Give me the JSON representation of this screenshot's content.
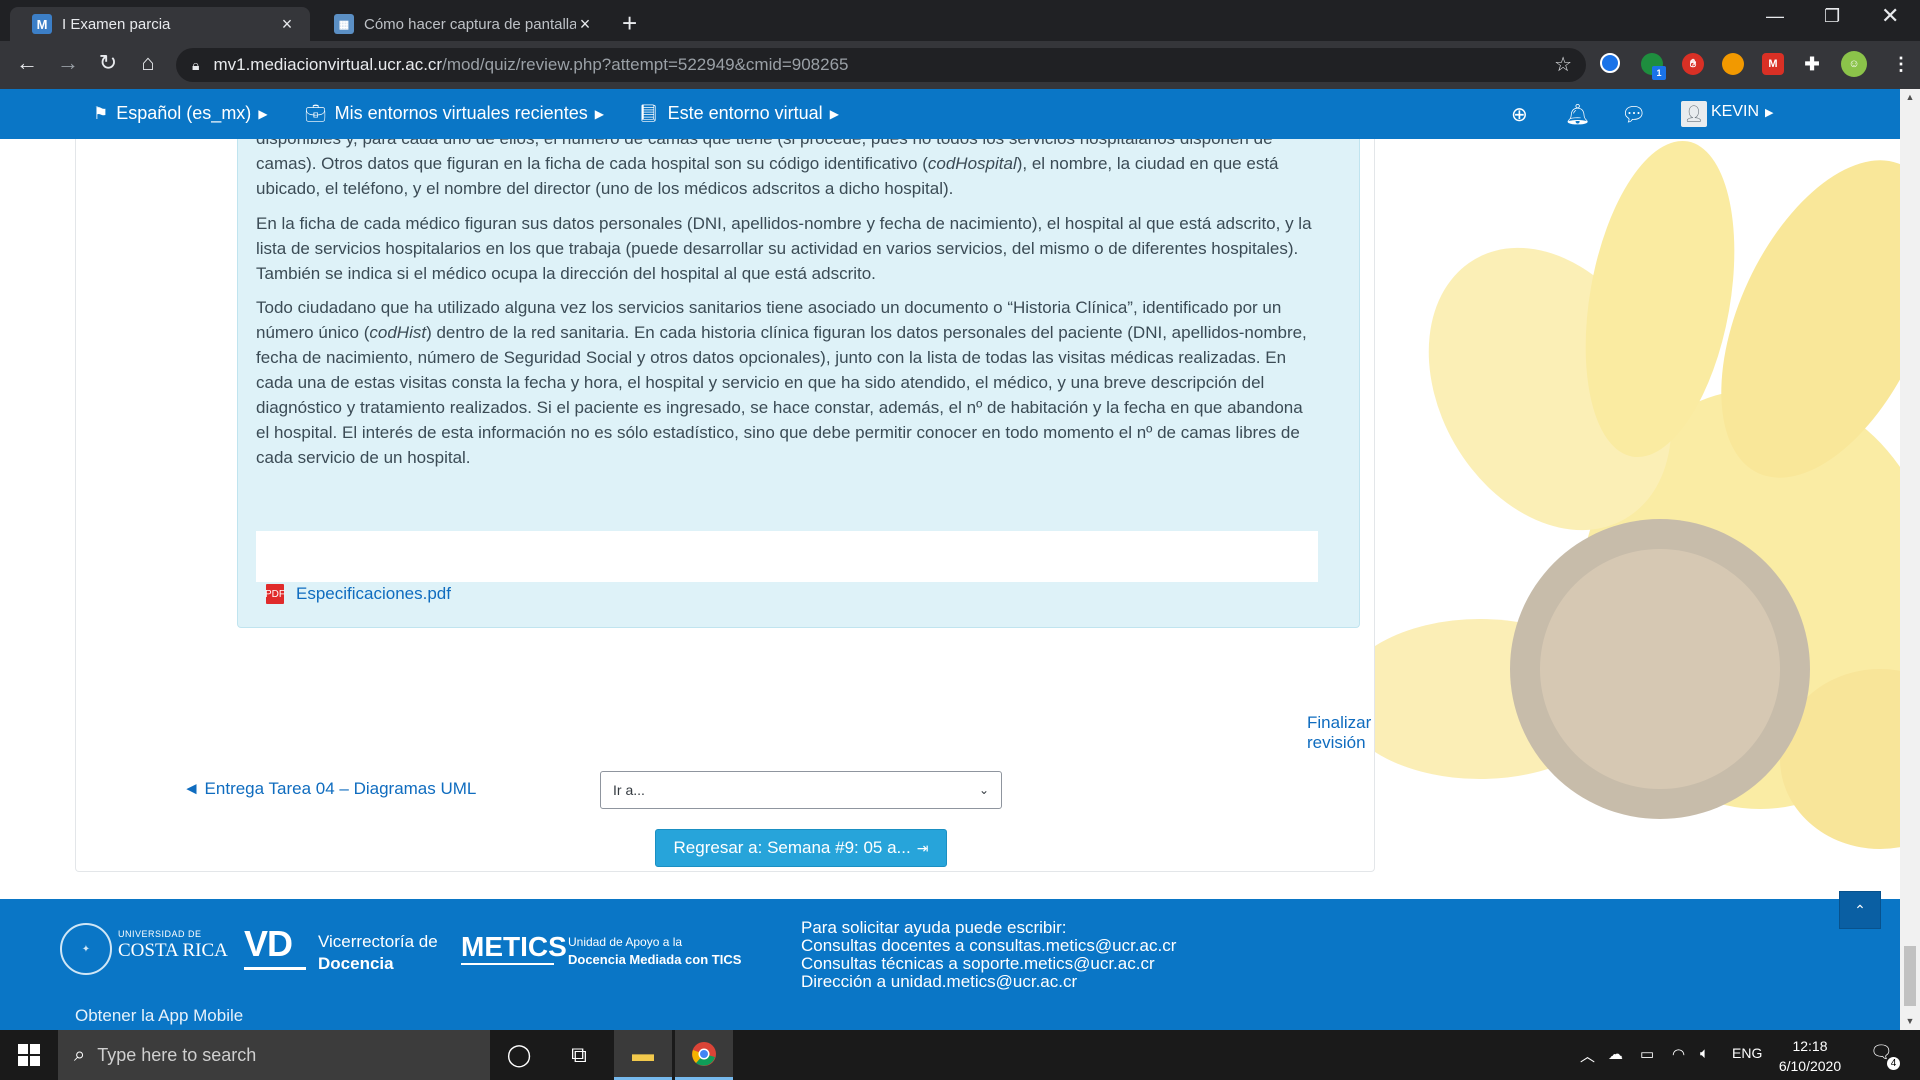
{
  "browser": {
    "tabs": [
      {
        "title": "I Examen parcia",
        "icon": "moodle-m-icon",
        "active": true
      },
      {
        "title": "Cómo hacer captura de pantalla",
        "icon": "page-image-icon",
        "active": false
      }
    ],
    "url_main": "mv1.mediacionvirtual.ucr.ac.cr",
    "url_path": "/mod/quiz/review.php?attempt=522949&cmid=908265",
    "new_tab_glyph": "+",
    "extensions": [
      "puzzle-icon",
      "profile-avatar-icon"
    ],
    "ext_badge": "1",
    "ext_m_label": "M"
  },
  "moodle_nav": {
    "language": "Español (es_mx)",
    "recent": "Mis entornos virtuales recientes",
    "this_course": "Este entorno virtual",
    "user": "KEVIN"
  },
  "question": {
    "partial_top": "disponibles y, para cada uno de ellos, el número de camas que tiene (si procede, pues no todos los servicios hospitalarios disponen de",
    "p1_a": "camas). Otros datos  que figuran en la ficha de cada hospital son su código identificativo (",
    "p1_em": "codHospital",
    "p1_b": "), el nombre, la ciudad en que está ubicado, el teléfono, y el nombre del director (uno de los médicos adscritos a dicho hospital).",
    "p2": "En la ficha de cada médico figuran sus datos personales (DNI, apellidos-nombre y fecha de nacimiento), el hospital al que está adscrito, y la lista de servicios hospitalarios en los que trabaja (puede desarrollar su actividad en varios servicios, del mismo o de diferentes hospitales). También se indica si el médico ocupa la dirección del hospital al que está adscrito.",
    "p3_a": "Todo ciudadano que ha utilizado alguna vez los servicios sanitarios tiene asociado un documento o “Historia Clínica”, identificado por un número único (",
    "p3_em": "codHist",
    "p3_b": ") dentro de la red sanitaria. En cada historia clínica figuran los datos personales del paciente (DNI, apellidos-nombre, fecha de nacimiento, número de Seguridad Social y otros datos opcionales), junto con la lista de todas las visitas médicas realizadas. En cada una de estas visitas consta la fecha y hora, el hospital y servicio en que ha sido atendido, el médico, y una breve descripción del diagnóstico y tratamiento realizados. Si el paciente es ingresado, se hace constar, además, el nº de habitación y la fecha en que abandona el hospital. El interés de esta información no es sólo estadístico, sino que debe permitir conocer en todo momento el nº de camas libres de cada servicio de un hospital.",
    "attachment": "Especificaciones.pdf",
    "attachment_icon_label": "PDF"
  },
  "navigation": {
    "finish_review": "Finalizar revisión",
    "prev_activity": "◄ Entrega Tarea 04 – Diagramas UML",
    "jump_placeholder": "Ir a...",
    "back_button": "Regresar a: Semana #9: 05 a..."
  },
  "footer": {
    "ucr_line1": "UNIVERSIDAD DE",
    "ucr_line2": "COSTA RICA",
    "vd": "VD",
    "vice_line1": "Vicerrectoría de",
    "vice_line2": "Docencia",
    "metics": "METICS",
    "unidad_line1": "Unidad de Apoyo a la",
    "unidad_line2": "Docencia Mediada con TICS",
    "help_lines": [
      "Para solicitar ayuda puede escribir:",
      "Consultas docentes a consultas.metics@ucr.ac.cr",
      "Consultas técnicas a soporte.metics@ucr.ac.cr",
      "Dirección a unidad.metics@ucr.ac.cr"
    ],
    "app_mobile": "Obtener la App Mobile"
  },
  "taskbar": {
    "search_placeholder": "Type here to search",
    "lang": "ENG",
    "time": "12:18",
    "date": "6/10/2020",
    "notifications": "4"
  },
  "colors": {
    "moodle_blue": "#0a76c6",
    "question_bg": "#def2f8",
    "link": "#0f6cbf",
    "button": "#27a4da"
  }
}
